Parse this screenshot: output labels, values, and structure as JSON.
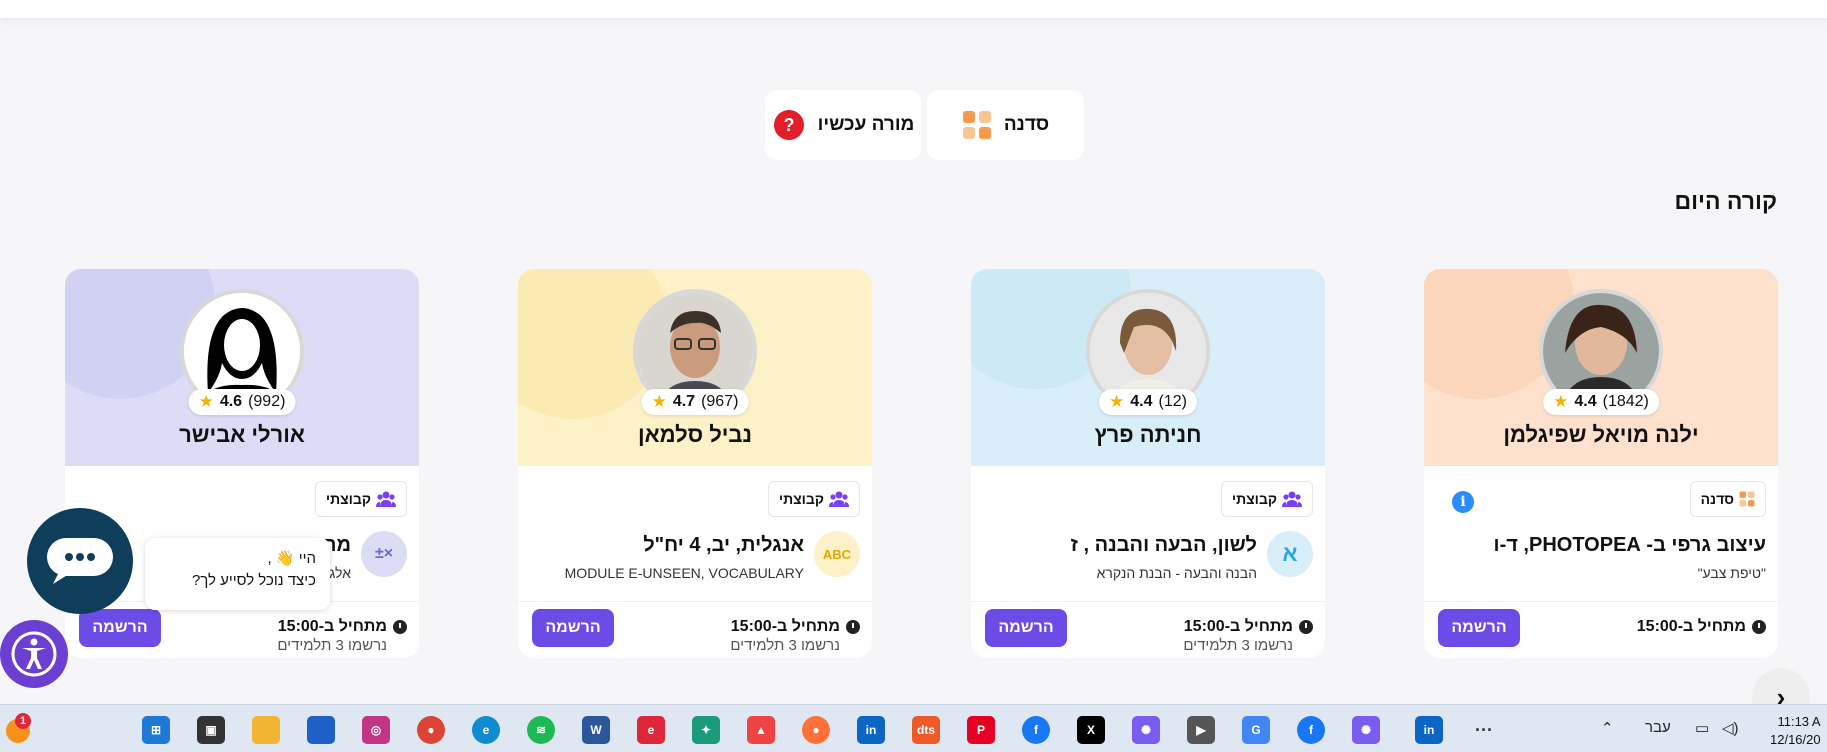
{
  "quick_links": {
    "sadna": "סדנה",
    "teacher_now": "מורה עכשיו"
  },
  "section_title": "קורה היום",
  "cards": [
    {
      "teacher": "ילנה מויאל שפיגלמן",
      "reviews": "(1842)",
      "rating": "4.4",
      "tag": "סדנה",
      "title": "עיצוב גרפי ב- PHOTOPEA, ד-ו",
      "subtitle": "\"טיפת צבע\"",
      "start": "מתחיל ב-15:00",
      "registered": "",
      "button": "הרשמה",
      "colors": {
        "top": "#fde1cc",
        "accent": "#f59a4b"
      }
    },
    {
      "teacher": "חניתה פרץ",
      "reviews": "(12)",
      "rating": "4.4",
      "tag": "קבוצתי",
      "title": "לשון, הבעה והבנה , ז",
      "subtitle": "הבנה והבעה - הבנת הנקרא",
      "icon": "א",
      "start": "מתחיל ב-15:00",
      "registered": "נרשמו 3 תלמידים",
      "button": "הרשמה",
      "colors": {
        "top": "#d8eef8",
        "accent": "#2aa7e0"
      }
    },
    {
      "teacher": "נביל סלמאן",
      "reviews": "(967)",
      "rating": "4.7",
      "tag": "קבוצתי",
      "title": "אנגלית, יב, 4 יח\"ל",
      "subtitle": "MODULE E-UNSEEN, VOCABULARY",
      "icon": "ABC",
      "start": "מתחיל ב-15:00",
      "registered": "נרשמו 3 תלמידים",
      "button": "הרשמה",
      "colors": {
        "top": "#fdf1c8",
        "accent": "#f3c21c"
      }
    },
    {
      "teacher": "אורלי אבישר",
      "reviews": "(992)",
      "rating": "4.6",
      "tag": "קבוצתי",
      "title": "מתמטיקה",
      "subtitle": "אלגברה",
      "icon": "±×",
      "start": "מתחיל ב-15:00",
      "registered": "נרשמו 3 תלמידים",
      "button": "הרשמה",
      "colors": {
        "top": "#dcdcf7",
        "accent": "#7a7ad8"
      }
    }
  ],
  "chat": {
    "greeting": "היי 👋 ,",
    "question": "כיצד נוכל לסייע לך?"
  },
  "taskbar": {
    "lang": "עבר",
    "time": "11:13 A",
    "date": "12/16/20",
    "badge": "1",
    "apps": [
      "windows-start",
      "task-view",
      "file-explorer",
      "store",
      "instagram",
      "chrome",
      "edge",
      "spotify",
      "word",
      "express",
      "butterfly",
      "ms-ribbon",
      "firefox",
      "linkedin",
      "dts",
      "pinterest",
      "facebook",
      "x",
      "copilot",
      "youtube",
      "translate",
      "facebook-2",
      "copilot-2",
      "linkedin-2",
      "more"
    ]
  }
}
